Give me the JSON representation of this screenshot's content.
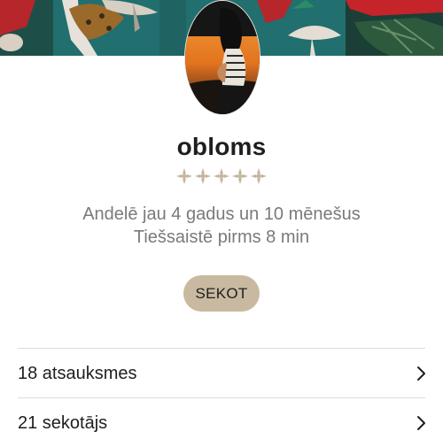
{
  "profile": {
    "username": "obloms",
    "rating_stars": 5,
    "member_since": "Andelē jau 4 gadus un 10 mēnešus",
    "last_online": "Tiešsaistē pirms 8 min",
    "follow_label": "SEKOT"
  },
  "stats": [
    {
      "label": "18 atsauksmes",
      "icon": "chevron-right-icon"
    },
    {
      "label": "21 sekotājs",
      "icon": "chevron-right-icon"
    }
  ],
  "colors": {
    "accent": "#c9b9a0",
    "star": "#c4b69f",
    "text": "#1e1e1e",
    "muted": "#7a7a7a",
    "divider": "#dcdcdc"
  }
}
